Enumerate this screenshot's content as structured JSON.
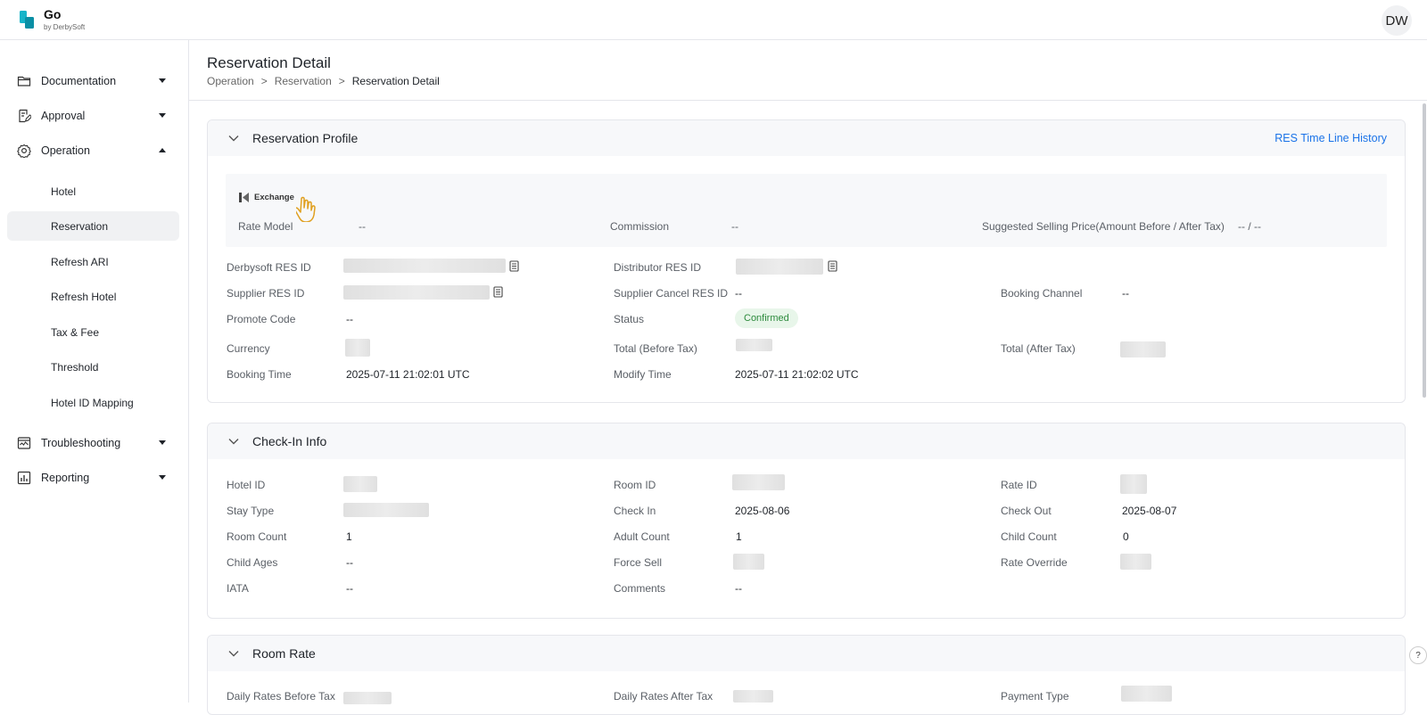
{
  "app": {
    "name": "Go",
    "subtitle": "by DerbySoft",
    "user_initials": "DW"
  },
  "sidebar": {
    "items": [
      {
        "label": "Documentation",
        "icon": "folder-icon"
      },
      {
        "label": "Approval",
        "icon": "edit-document-icon"
      },
      {
        "label": "Operation",
        "icon": "gear-icon",
        "expanded": true
      },
      {
        "label": "Troubleshooting",
        "icon": "diagnostic-icon"
      },
      {
        "label": "Reporting",
        "icon": "report-chart-icon"
      }
    ],
    "operation_children": [
      "Hotel",
      "Reservation",
      "Refresh ARI",
      "Refresh Hotel",
      "Tax & Fee",
      "Threshold",
      "Hotel ID Mapping"
    ],
    "active": "Reservation"
  },
  "header": {
    "title": "Reservation Detail",
    "breadcrumb": [
      "Operation",
      ">",
      "Reservation",
      ">",
      "Reservation Detail"
    ]
  },
  "profile": {
    "title": "Reservation Profile",
    "history_link": "RES Time Line History",
    "exchange_label": "Exchange",
    "rate_model_label": "Rate Model",
    "rate_model_value": "--",
    "commission_label": "Commission",
    "commission_value": "--",
    "ssp_label": "Suggested Selling Price(Amount Before / After Tax)",
    "ssp_value": "-- / --",
    "derbysoft_res_id_label": "Derbysoft RES ID",
    "distributor_res_id_label": "Distributor RES ID",
    "supplier_res_id_label": "Supplier RES ID",
    "supplier_cancel_res_id_label": "Supplier Cancel RES ID",
    "supplier_cancel_res_id_value": "--",
    "booking_channel_label": "Booking Channel",
    "booking_channel_value": "--",
    "promote_code_label": "Promote Code",
    "promote_code_value": "--",
    "status_label": "Status",
    "status_value": "Confirmed",
    "currency_label": "Currency",
    "total_before_tax_label": "Total (Before Tax)",
    "total_after_tax_label": "Total (After Tax)",
    "booking_time_label": "Booking Time",
    "booking_time_value": "2025-07-11 21:02:01 UTC",
    "modify_time_label": "Modify Time",
    "modify_time_value": "2025-07-11 21:02:02 UTC"
  },
  "checkin": {
    "title": "Check-In Info",
    "hotel_id_label": "Hotel ID",
    "room_id_label": "Room ID",
    "rate_id_label": "Rate ID",
    "stay_type_label": "Stay Type",
    "check_in_label": "Check In",
    "check_in_value": "2025-08-06",
    "check_out_label": "Check Out",
    "check_out_value": "2025-08-07",
    "room_count_label": "Room Count",
    "room_count_value": "1",
    "adult_count_label": "Adult Count",
    "adult_count_value": "1",
    "child_count_label": "Child Count",
    "child_count_value": "0",
    "child_ages_label": "Child Ages",
    "child_ages_value": "--",
    "force_sell_label": "Force Sell",
    "rate_override_label": "Rate Override",
    "iata_label": "IATA",
    "iata_value": "--",
    "comments_label": "Comments",
    "comments_value": "--"
  },
  "room_rate": {
    "title": "Room Rate",
    "daily_before_label": "Daily Rates Before Tax",
    "daily_after_label": "Daily Rates After Tax",
    "payment_type_label": "Payment Type"
  },
  "colors": {
    "link": "#1a73e8",
    "status_bg": "#e8f6ea",
    "status_text": "#2e8b3e",
    "panel_bg": "#f7f8fa"
  }
}
